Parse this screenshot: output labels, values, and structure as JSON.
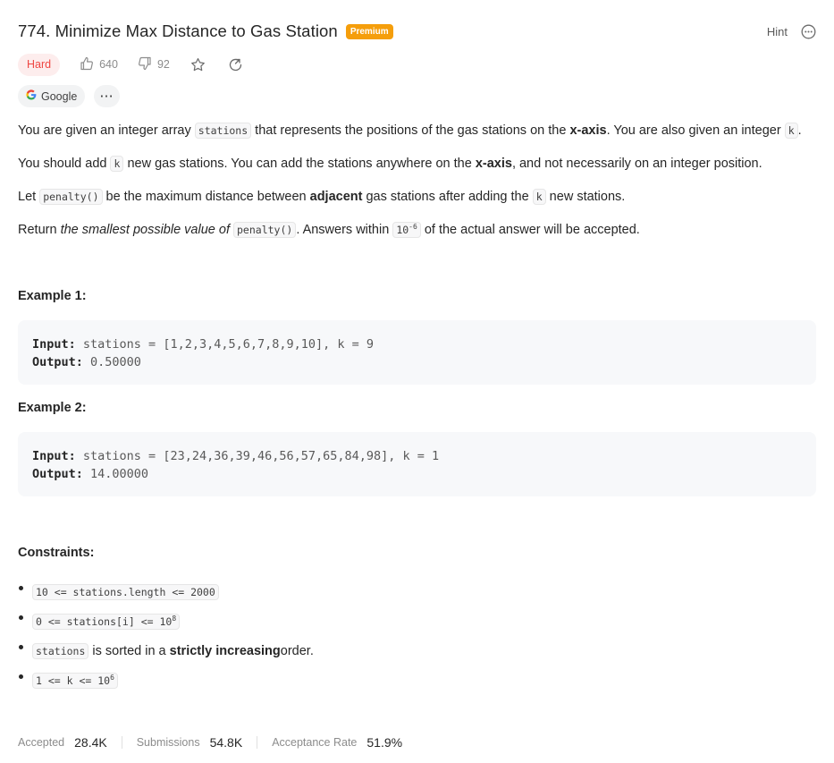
{
  "problem": {
    "title": "774. Minimize Max Distance to Gas Station",
    "premium_label": "Premium",
    "hint_label": "Hint"
  },
  "meta": {
    "difficulty": "Hard",
    "likes": "640",
    "dislikes": "92"
  },
  "tags": {
    "company": "Google",
    "more": "···"
  },
  "description": {
    "p1_a": "You are given an integer array ",
    "p1_code1": "stations",
    "p1_b": " that represents the positions of the gas stations on the ",
    "p1_bold": "x-axis",
    "p1_c": ". You are also given an integer ",
    "p1_code2": "k",
    "p1_d": ".",
    "p2_a": "You should add ",
    "p2_code": "k",
    "p2_b": " new gas stations. You can add the stations anywhere on the ",
    "p2_bold": "x-axis",
    "p2_c": ", and not necessarily on an integer position.",
    "p3_a": "Let ",
    "p3_code1": "penalty()",
    "p3_b": " be the maximum distance between ",
    "p3_bold": "adjacent",
    "p3_c": " gas stations after adding the ",
    "p3_code2": "k",
    "p3_d": " new stations.",
    "p4_a": "Return ",
    "p4_italic": "the smallest possible value of",
    "p4_space": " ",
    "p4_code1": "penalty()",
    "p4_b": ". Answers within ",
    "p4_code2_base": "10",
    "p4_code2_exp": "-6",
    "p4_c": " of the actual answer will be accepted."
  },
  "examples": [
    {
      "title": "Example 1:",
      "input_label": "Input:",
      "input_value": " stations = [1,2,3,4,5,6,7,8,9,10], k = 9",
      "output_label": "Output:",
      "output_value": " 0.50000"
    },
    {
      "title": "Example 2:",
      "input_label": "Input:",
      "input_value": " stations = [23,24,36,39,46,56,57,65,84,98], k = 1",
      "output_label": "Output:",
      "output_value": " 14.00000"
    }
  ],
  "constraints": {
    "title": "Constraints:",
    "c1": "10 <= stations.length <= 2000",
    "c2_base": "0 <= stations[i] <= 10",
    "c2_exp": "8",
    "c3_code": "stations",
    "c3_a": " is sorted in a ",
    "c3_bold": "strictly increasing",
    "c3_b": " order.",
    "c4_base": "1 <= k <= 10",
    "c4_exp": "6"
  },
  "stats": {
    "accepted_label": "Accepted",
    "accepted_value": "28.4K",
    "submissions_label": "Submissions",
    "submissions_value": "54.8K",
    "rate_label": "Acceptance Rate",
    "rate_value": "51.9%"
  },
  "colors": {
    "premium": "#f59e0b",
    "hard": "#ef4743",
    "hard_bg": "#fdeded"
  }
}
